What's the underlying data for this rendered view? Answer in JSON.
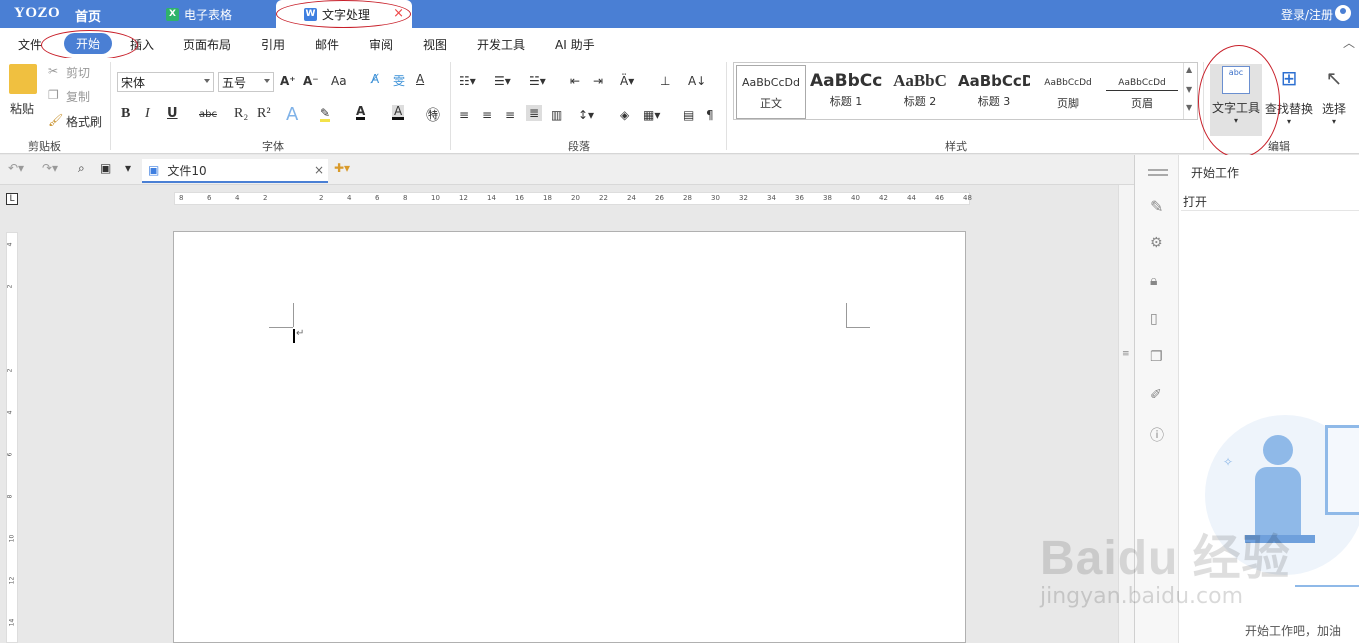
{
  "app": {
    "brand": "YOZO",
    "home": "首页",
    "login": "登录/注册"
  },
  "tabs": [
    {
      "label": "电子表格",
      "icon_letter": "X",
      "icon_color": "#2fb36b"
    },
    {
      "label": "文字处理",
      "icon_letter": "W",
      "icon_color": "#3f7fe0",
      "close": "×"
    }
  ],
  "menu": [
    "文件",
    "开始",
    "插入",
    "页面布局",
    "引用",
    "邮件",
    "审阅",
    "视图",
    "开发工具",
    "AI 助手"
  ],
  "ribbon": {
    "clipboard": {
      "paste": "粘贴",
      "cut": "剪切",
      "copy": "复制",
      "format_painter": "格式刷",
      "label": "剪贴板"
    },
    "font": {
      "family": "宋体",
      "size": "五号",
      "label": "字体",
      "grow": "A⁺",
      "shrink": "A⁻",
      "case": "Aa",
      "bold": "B",
      "italic": "I",
      "underline": "U",
      "strike": "abc",
      "sub": "R₂",
      "sup": "R²"
    },
    "paragraph": {
      "label": "段落"
    },
    "styles": {
      "label": "样式",
      "items": [
        {
          "sample": "AaBbCcDd",
          "name": "正文"
        },
        {
          "sample": "AaBbCc",
          "name": "标题 1"
        },
        {
          "sample": "AaBbC",
          "name": "标题 2"
        },
        {
          "sample": "AaBbCcD",
          "name": "标题 3"
        },
        {
          "sample": "AaBbCcDd",
          "name": "页脚"
        },
        {
          "sample": "AaBbCcDd",
          "name": "页眉"
        }
      ]
    },
    "edit": {
      "text_tools": "文字工具",
      "find_replace": "查找替换",
      "select": "选择",
      "label": "编辑"
    }
  },
  "document": {
    "tab_label": "文件10",
    "close": "×",
    "para_mark": "↵"
  },
  "ruler": {
    "h": [
      "8",
      "6",
      "4",
      "2",
      "",
      "2",
      "4",
      "6",
      "8",
      "10",
      "12",
      "14",
      "16",
      "18",
      "20",
      "22",
      "24",
      "26",
      "28",
      "30",
      "32",
      "34",
      "36",
      "38",
      "40",
      "42",
      "44",
      "46",
      "48"
    ],
    "v": [
      "4",
      "2",
      "",
      "2",
      "4",
      "6",
      "8",
      "10",
      "12",
      "14"
    ]
  },
  "pane": {
    "title": "开始工作",
    "open": "打开",
    "hint": "开始工作吧，加油"
  },
  "watermark": {
    "main": "Baidu 经验",
    "sub": "jingyan.baidu.com"
  }
}
